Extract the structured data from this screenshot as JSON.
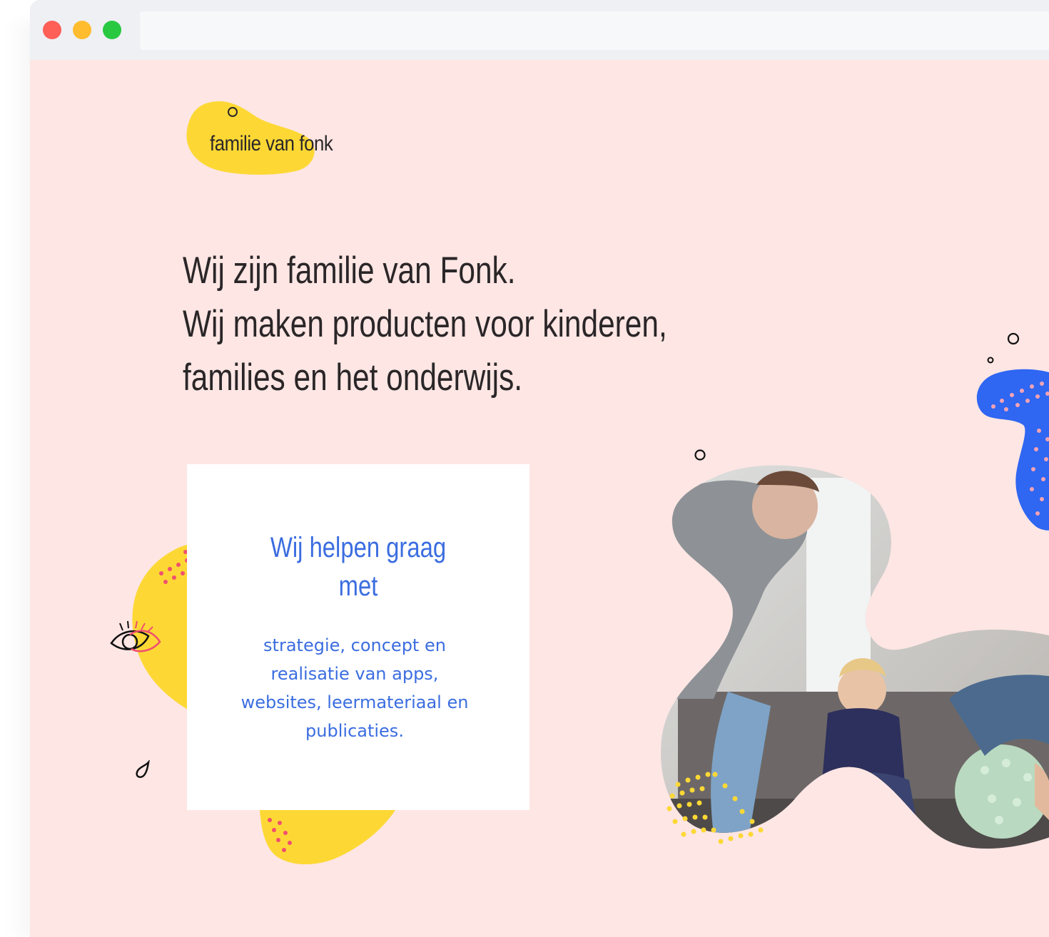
{
  "window": {
    "controls": [
      "close",
      "minimize",
      "zoom"
    ],
    "colors": {
      "close": "#fe5f57",
      "minimize": "#febc2e",
      "zoom": "#28c840"
    }
  },
  "logo": {
    "text": "familie van fonk"
  },
  "hero": {
    "lines": [
      "Wij zijn familie van Fonk.",
      "Wij maken producten voor kinderen,",
      "families en het onderwijs."
    ]
  },
  "card": {
    "title": "Wij helpen graag met",
    "body": "strategie, concept en realisatie van apps, websites, leermateriaal en publicaties."
  },
  "colors": {
    "background": "#fde6e4",
    "accent_blue": "#3b6de0",
    "blob_yellow": "#fdd835",
    "blob_blue": "#2f66f2",
    "text_dark": "#2a2628"
  },
  "icons": [
    "eye-icon",
    "drop-icon",
    "circle-outline-icon"
  ]
}
